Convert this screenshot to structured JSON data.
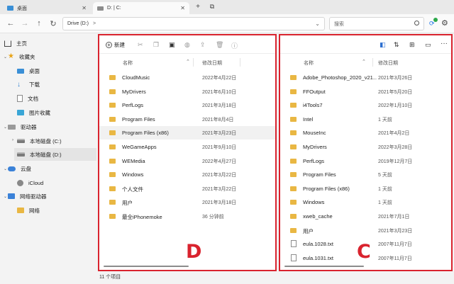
{
  "tabs": [
    {
      "label": "桌面"
    },
    {
      "label": "D: | C:"
    }
  ],
  "toolbar": {
    "back": "←",
    "forward": "→",
    "up": "↑",
    "refresh": "↻",
    "new_tab": "+",
    "tab_options": "⧉"
  },
  "address": {
    "path": "Drive (D:)",
    "chevron_sep": ">"
  },
  "search": {
    "placeholder": "搜索"
  },
  "sidebar": {
    "items": [
      {
        "label": "主页"
      },
      {
        "label": "收藏夹"
      },
      {
        "label": "桌面"
      },
      {
        "label": "下载"
      },
      {
        "label": "文档"
      },
      {
        "label": "图片收藏"
      },
      {
        "label": "驱动器"
      },
      {
        "label": "本地磁盘 (C:)"
      },
      {
        "label": "本地磁盘 (D:)"
      },
      {
        "label": "云盘"
      },
      {
        "label": "iCloud"
      },
      {
        "label": "网络驱动器"
      },
      {
        "label": "网络"
      }
    ]
  },
  "panel_d": {
    "new_label": "新建",
    "col_name": "名称",
    "col_date": "修改日期",
    "rows": [
      {
        "name": "CloudMusic",
        "date": "2022年4月22日"
      },
      {
        "name": "MyDrivers",
        "date": "2021年6月10日"
      },
      {
        "name": "PerfLogs",
        "date": "2021年3月18日"
      },
      {
        "name": "Program Files",
        "date": "2021年8月4日"
      },
      {
        "name": "Program Files (x86)",
        "date": "2021年3月23日"
      },
      {
        "name": "WeGameApps",
        "date": "2021年9月10日"
      },
      {
        "name": "WEMedia",
        "date": "2022年4月27日"
      },
      {
        "name": "Windows",
        "date": "2021年3月22日"
      },
      {
        "name": "个人文件",
        "date": "2021年3月22日"
      },
      {
        "name": "用户",
        "date": "2021年3月18日"
      },
      {
        "name": "最全iPhonemoke",
        "date": "36 分钟前"
      }
    ],
    "letter": "D"
  },
  "panel_c": {
    "col_name": "名称",
    "col_date": "修改日期",
    "more": "···",
    "rows": [
      {
        "name": "Adobe_Photoshop_2020_v21...",
        "date": "2021年3月26日",
        "type": "folder"
      },
      {
        "name": "FFOutput",
        "date": "2021年5月20日",
        "type": "folder"
      },
      {
        "name": "i4Tools7",
        "date": "2022年1月10日",
        "type": "folder"
      },
      {
        "name": "Intel",
        "date": "1 天前",
        "type": "folder"
      },
      {
        "name": "MouseInc",
        "date": "2021年4月2日",
        "type": "folder"
      },
      {
        "name": "MyDrivers",
        "date": "2022年3月28日",
        "type": "folder"
      },
      {
        "name": "PerfLogs",
        "date": "2019年12月7日",
        "type": "folder"
      },
      {
        "name": "Program Files",
        "date": "5 天前",
        "type": "folder"
      },
      {
        "name": "Program Files (x86)",
        "date": "1 天前",
        "type": "folder"
      },
      {
        "name": "Windows",
        "date": "1 天前",
        "type": "folder"
      },
      {
        "name": "xweb_cache",
        "date": "2021年7月1日",
        "type": "folder"
      },
      {
        "name": "用户",
        "date": "2021年3月23日",
        "type": "folder"
      },
      {
        "name": "eula.1028.txt",
        "date": "2007年11月7日",
        "type": "file"
      },
      {
        "name": "eula.1031.txt",
        "date": "2007年11月7日",
        "type": "file"
      }
    ],
    "letter": "C"
  },
  "status": {
    "count": "11 个项目"
  },
  "colors": {
    "accent_red": "#d9232e",
    "folder": "#e9b743",
    "selection": "#e4e4e4"
  }
}
